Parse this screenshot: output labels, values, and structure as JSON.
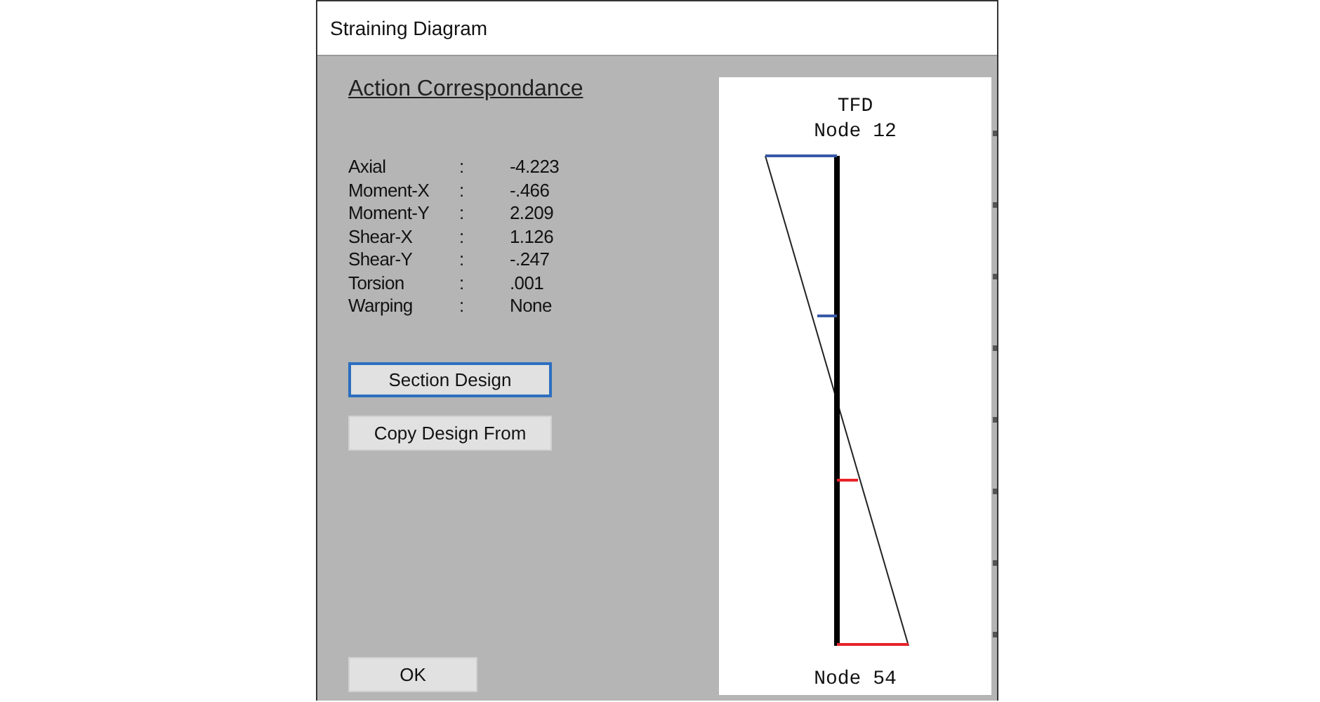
{
  "window": {
    "title": "Straining Diagram"
  },
  "heading": "Action Correspondance",
  "actions": [
    {
      "label": "Axial",
      "separator": ":",
      "value": "-4.223"
    },
    {
      "label": "Moment-X",
      "separator": ":",
      "value": "-.466"
    },
    {
      "label": "Moment-Y",
      "separator": ":",
      "value": "2.209"
    },
    {
      "label": "Shear-X",
      "separator": ":",
      "value": "1.126"
    },
    {
      "label": "Shear-Y",
      "separator": ":",
      "value": "-.247"
    },
    {
      "label": "Torsion",
      "separator": ":",
      "value": ".001"
    },
    {
      "label": "Warping",
      "separator": ":",
      "value": "None"
    }
  ],
  "buttons": [
    {
      "label": "Section Design",
      "focused": true
    },
    {
      "label": "Copy Design From",
      "focused": false
    }
  ],
  "ok_button": {
    "label": "OK"
  },
  "diagram": {
    "title": "TFD",
    "top_node": "Node 12",
    "bottom_node": "Node 54"
  }
}
